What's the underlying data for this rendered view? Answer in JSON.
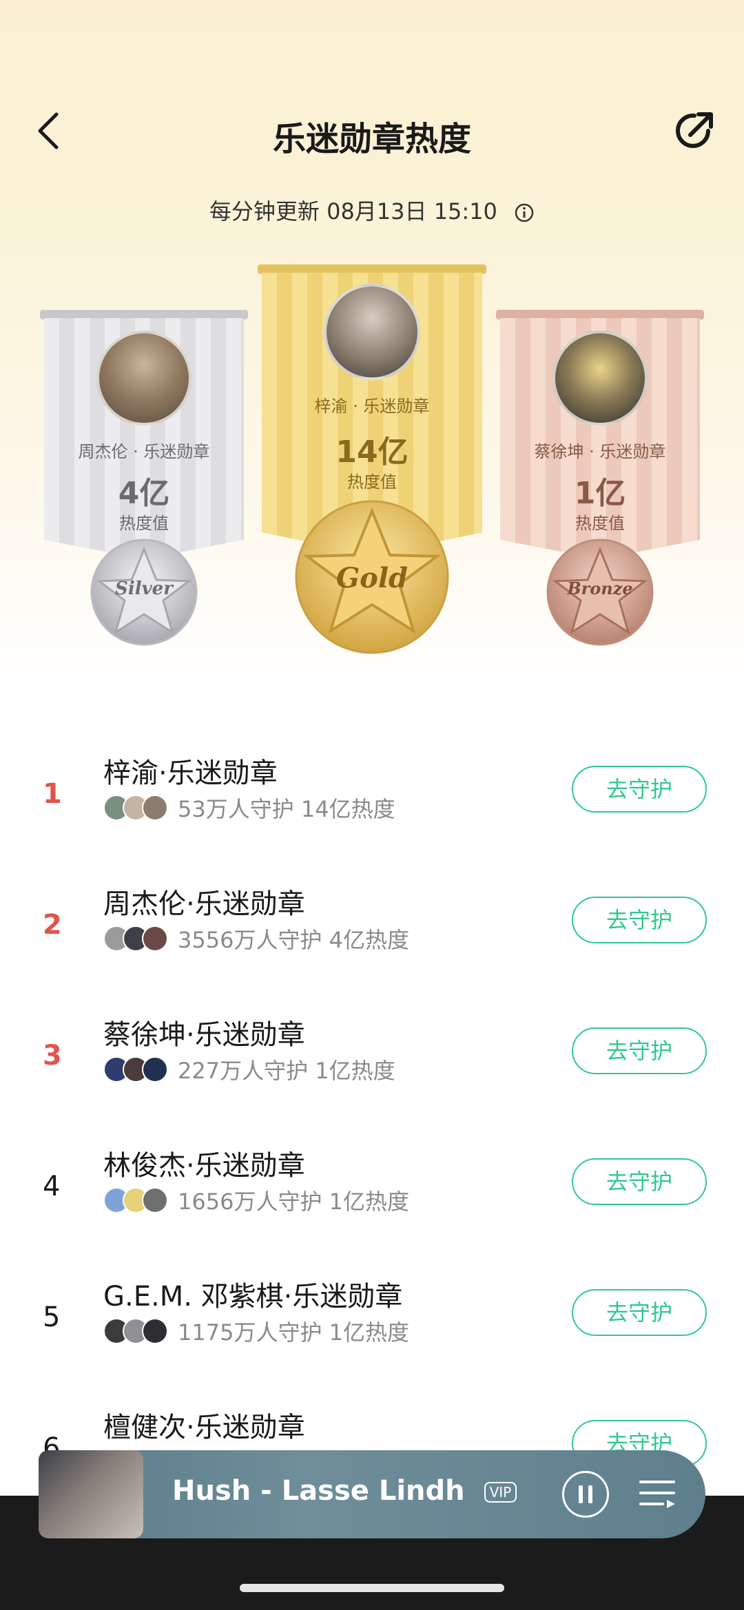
{
  "header": {
    "title": "乐迷勋章热度",
    "update_text": "每分钟更新 08月13日 15:10"
  },
  "podium": {
    "gold": {
      "name": "梓渝 · 乐迷勋章",
      "value": "14亿",
      "label": "热度值",
      "medal": "Gold"
    },
    "silver": {
      "name": "周杰伦 · 乐迷勋章",
      "value": "4亿",
      "label": "热度值",
      "medal": "Silver"
    },
    "bronze": {
      "name": "蔡徐坤 · 乐迷勋章",
      "value": "1亿",
      "label": "热度值",
      "medal": "Bronze"
    }
  },
  "ranking": [
    {
      "rank": "1",
      "name": "梓渝·乐迷勋章",
      "stats": "53万人守护  14亿热度",
      "button": "去守护"
    },
    {
      "rank": "2",
      "name": "周杰伦·乐迷勋章",
      "stats": "3556万人守护  4亿热度",
      "button": "去守护"
    },
    {
      "rank": "3",
      "name": "蔡徐坤·乐迷勋章",
      "stats": "227万人守护  1亿热度",
      "button": "去守护"
    },
    {
      "rank": "4",
      "name": "林俊杰·乐迷勋章",
      "stats": "1656万人守护  1亿热度",
      "button": "去守护"
    },
    {
      "rank": "5",
      "name": "G.E.M. 邓紫棋·乐迷勋章",
      "stats": "1175万人守护  1亿热度",
      "button": "去守护"
    },
    {
      "rank": "6",
      "name": "檀健次·乐迷勋章",
      "stats": "",
      "button": "去守护"
    }
  ],
  "player": {
    "song": "Hush - Lasse Lindh",
    "badge": "VIP"
  },
  "colors": {
    "accent_green": "#2fc98f",
    "top_rank_red": "#e0554d",
    "gold": "#e8c35a",
    "silver": "#cfcfd2",
    "bronze": "#e6b7a6"
  }
}
